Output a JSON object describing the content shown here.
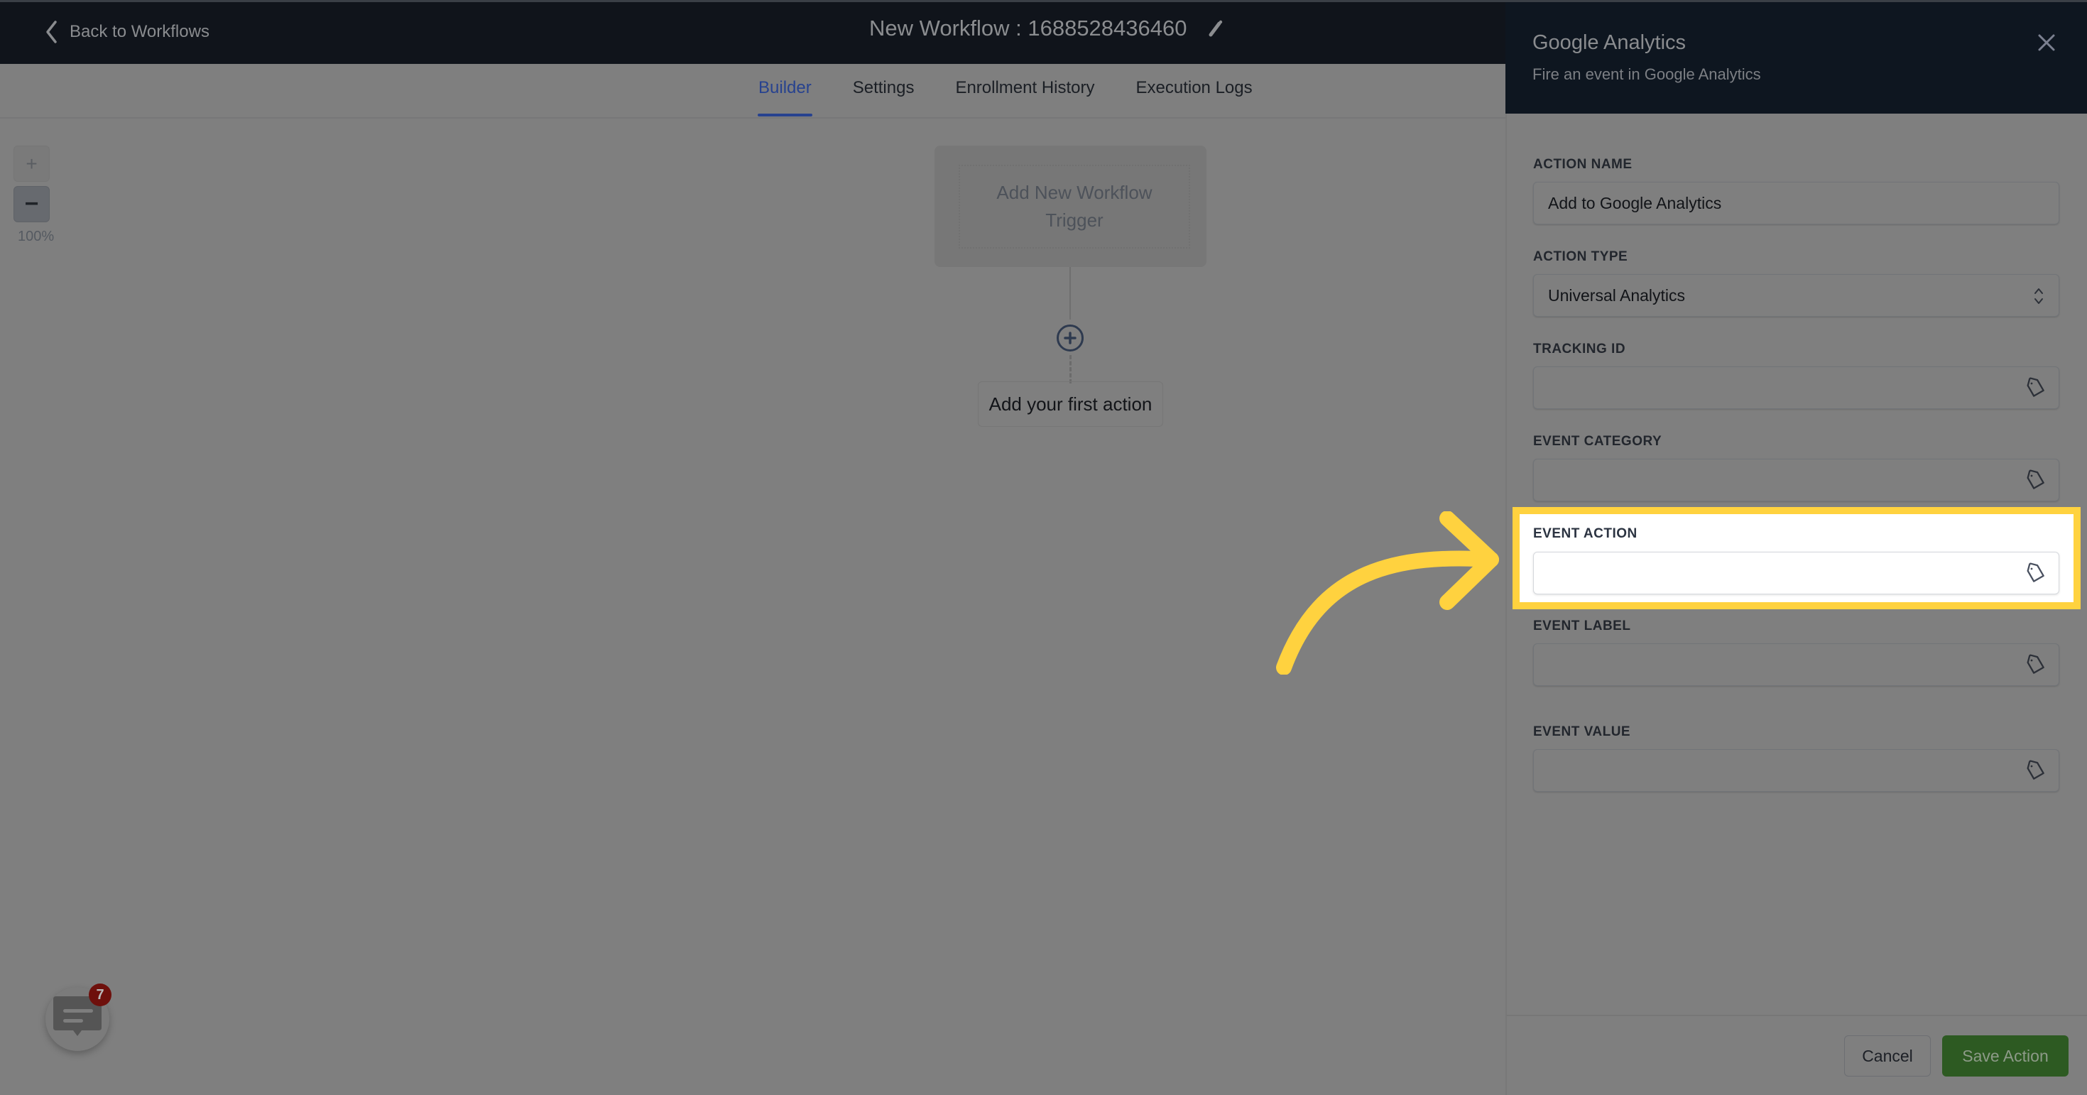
{
  "header": {
    "back_label": "Back to Workflows",
    "workflow_title": "New Workflow : 1688528436460"
  },
  "tabs": [
    {
      "label": "Builder",
      "active": true
    },
    {
      "label": "Settings",
      "active": false
    },
    {
      "label": "Enrollment History",
      "active": false
    },
    {
      "label": "Execution Logs",
      "active": false
    }
  ],
  "canvas": {
    "zoom_in_label": "+",
    "zoom_out_label": "−",
    "zoom_level": "100%",
    "trigger_label": "Add New Workflow Trigger",
    "first_action_label": "Add your first action"
  },
  "chat_widget": {
    "badge_count": "7"
  },
  "panel": {
    "title": "Google Analytics",
    "subtitle": "Fire an event in Google Analytics",
    "fields": [
      {
        "label": "ACTION NAME",
        "value": "Add to Google Analytics",
        "type": "text"
      },
      {
        "label": "ACTION TYPE",
        "value": "Universal Analytics",
        "type": "select"
      },
      {
        "label": "TRACKING ID",
        "value": "",
        "type": "tag"
      },
      {
        "label": "EVENT CATEGORY",
        "value": "",
        "type": "tag"
      },
      {
        "label": "EVENT ACTION",
        "value": "",
        "type": "tag",
        "highlighted": true
      },
      {
        "label": "EVENT LABEL",
        "value": "",
        "type": "tag"
      },
      {
        "label": "EVENT VALUE",
        "value": "",
        "type": "tag"
      }
    ],
    "cancel_label": "Cancel",
    "save_label": "Save Action"
  },
  "annotation": {
    "highlight_color": "#ffd23f",
    "highlighted_field": "EVENT ACTION"
  }
}
